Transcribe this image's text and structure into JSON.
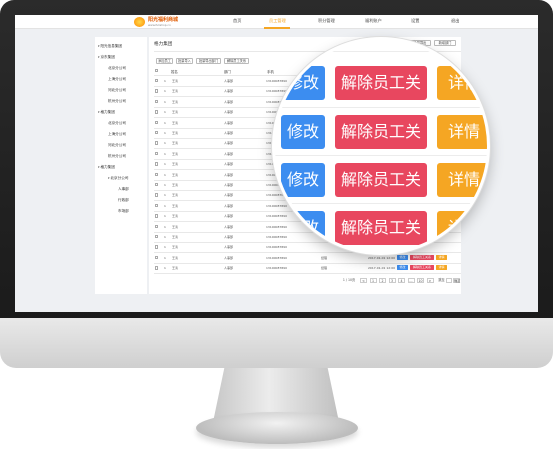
{
  "logo": {
    "title": "阳光福利商城",
    "subtitle": "www.fulishop.cn"
  },
  "nav": [
    "首页",
    "员工管理",
    "积分管理",
    "福利账户",
    "设置",
    "退出"
  ],
  "sidebar": {
    "groups": [
      {
        "label": "阳光信息集团",
        "children": []
      },
      {
        "label": "京东集团",
        "children": [
          "北京分公司",
          "上海分公司",
          "河北分公司",
          "杭州分公司"
        ]
      },
      {
        "label": "格力集团",
        "children": [
          "北京分公司",
          "上海分公司",
          "河北分公司",
          "杭州分公司"
        ]
      },
      {
        "label": "格力集团",
        "children": [
          "北京分公司",
          "人事部",
          "行政部",
          "市场部"
        ]
      }
    ]
  },
  "panel": {
    "title": "格力集团",
    "top_buttons": [
      "添加",
      "批量导出",
      "新增部门"
    ],
    "toolbar": [
      "添加员工",
      "批量导入",
      "批量导出部门",
      "解除员工关系"
    ],
    "columns": [
      "",
      "姓名",
      "部门",
      "手机",
      "",
      "操作"
    ],
    "row": {
      "index": "1",
      "name": "王涛",
      "dept": "人事部",
      "phone": "13100087890",
      "role": "经理",
      "date": "2017-01-01 12:00"
    },
    "row_buttons": {
      "edit": "修改",
      "remove": "解除员工关系",
      "detail": "详情"
    },
    "pagination": {
      "summary": "1 / 10页",
      "pages": [
        "<",
        "1",
        "2",
        "3",
        "4",
        "…",
        "10",
        ">"
      ],
      "goto": "跳至",
      "go": "确定"
    }
  },
  "magnifier": {
    "edit": "修改",
    "remove": "解除员工关系",
    "detail": "详情"
  }
}
